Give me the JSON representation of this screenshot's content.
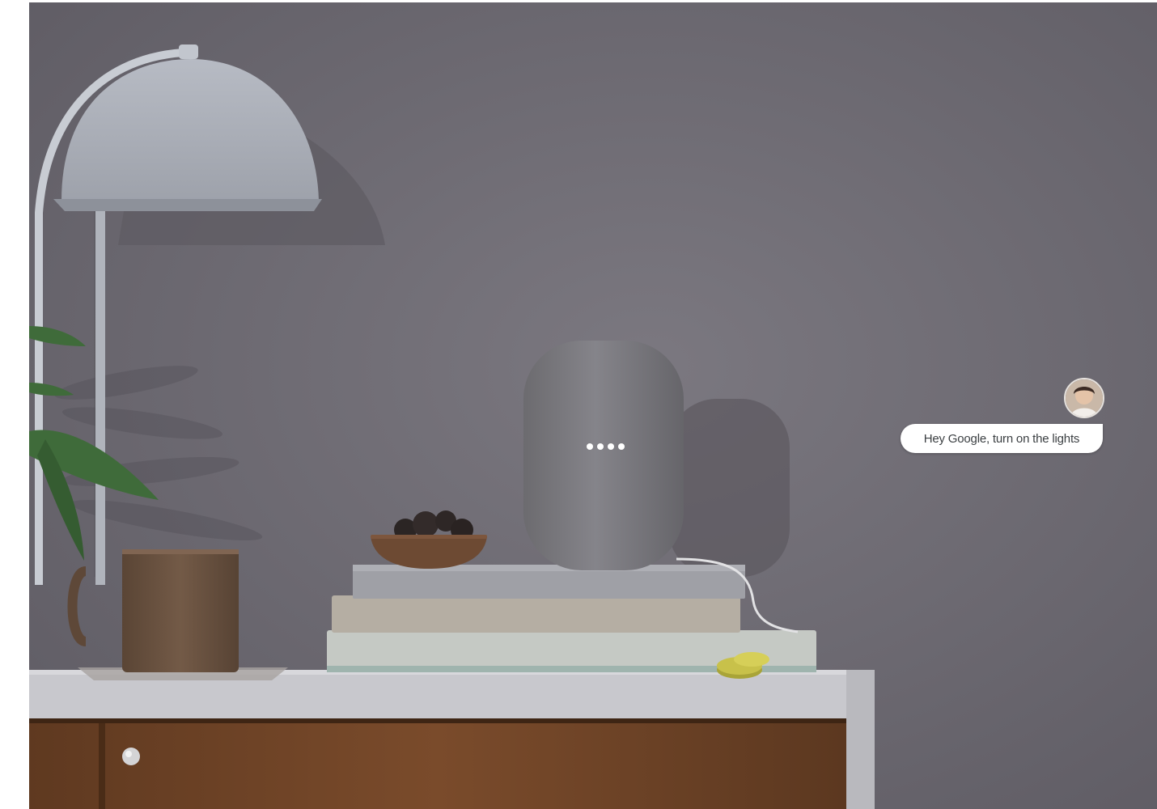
{
  "scene": {
    "colors": {
      "wall": "#6f6c72",
      "speaker": "#7a797c",
      "speaker_lights": "#ffffff",
      "lamp": "#a9adb6",
      "mug": "#6a5240",
      "dresser_top": "#c8c8cd",
      "dresser_wood": "#6e4426",
      "plant": "#3f6b3a",
      "books": [
        "#9fa0a6",
        "#b5aea3",
        "#c5c9c4"
      ],
      "coins": "#c8c14a"
    },
    "icons": [
      "lamp-illustration",
      "smart-speaker",
      "plant-leaves",
      "mug",
      "bowl",
      "book-stack",
      "coins",
      "dresser",
      "drawer-knob"
    ]
  },
  "assistant": {
    "query": "Hey Google, turn on the lights",
    "avatar_icon": "user-avatar-icon"
  }
}
